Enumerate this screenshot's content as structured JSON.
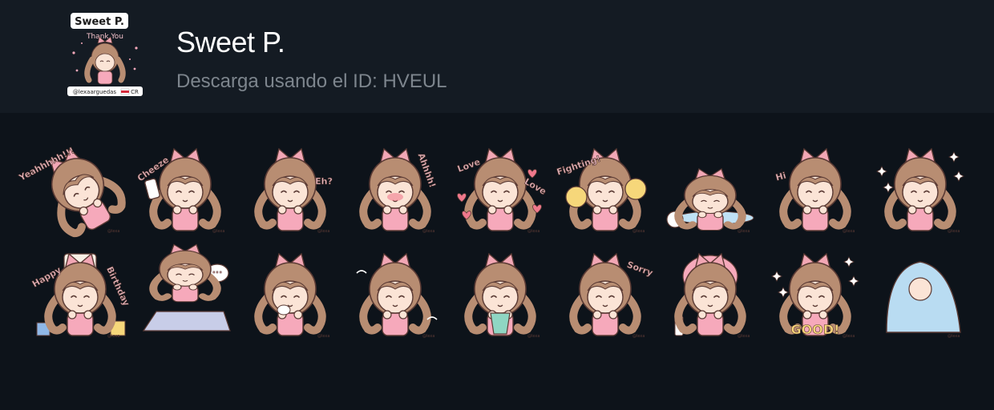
{
  "pack": {
    "title": "Sweet P.",
    "subtitle": "Descarga usando el ID: HVEUL"
  },
  "cover": {
    "heading": "Sweet P.",
    "tagline": "Thank You",
    "credit": "@lexaarguedas",
    "flag": "CR"
  },
  "colors": {
    "header_bg": "#141b23",
    "page_bg": "#0d131a",
    "hair": "#b88d72",
    "skin": "#fbe4d6",
    "outline": "#5a3a34",
    "bow": "#f2a7b5",
    "shirt": "#f6a9bb"
  },
  "stickers": [
    {
      "name": "sticker-yeah",
      "caption": "Yeahhhhh!!!",
      "watermark": "@lexa"
    },
    {
      "name": "sticker-cheeze",
      "caption": "Cheeze",
      "watermark": "@lexa"
    },
    {
      "name": "sticker-eh",
      "caption": "Eh?",
      "watermark": "@lexa"
    },
    {
      "name": "sticker-ahhhh",
      "caption": "Ahhhh!",
      "watermark": "@lexa"
    },
    {
      "name": "sticker-love",
      "caption": "Love",
      "caption2": "Love",
      "watermark": "@lexa"
    },
    {
      "name": "sticker-fighting",
      "caption": "Fighting!",
      "watermark": "@lexa"
    },
    {
      "name": "sticker-lying-down",
      "caption": "",
      "watermark": "@lexa"
    },
    {
      "name": "sticker-hi",
      "caption": "Hi",
      "watermark": "@lexa"
    },
    {
      "name": "sticker-sparkle",
      "caption": "",
      "watermark": "@lexa"
    },
    {
      "name": "sticker-happy-birthday",
      "caption": "Happy",
      "caption2": "Birthday",
      "watermark": "@lexa"
    },
    {
      "name": "sticker-planking",
      "caption": "...",
      "watermark": ""
    },
    {
      "name": "sticker-cough",
      "caption": "",
      "watermark": "@lexa"
    },
    {
      "name": "sticker-angry",
      "caption": "",
      "watermark": "@lexa"
    },
    {
      "name": "sticker-crying",
      "caption": "",
      "watermark": "@lexa"
    },
    {
      "name": "sticker-sorry",
      "caption": "Sorry",
      "watermark": "@lexa"
    },
    {
      "name": "sticker-face-mask",
      "caption": "",
      "watermark": "@lexa"
    },
    {
      "name": "sticker-good",
      "caption": "GOOD!",
      "watermark": "@lexa"
    },
    {
      "name": "sticker-blanket",
      "caption": "",
      "watermark": "@lexa"
    }
  ]
}
